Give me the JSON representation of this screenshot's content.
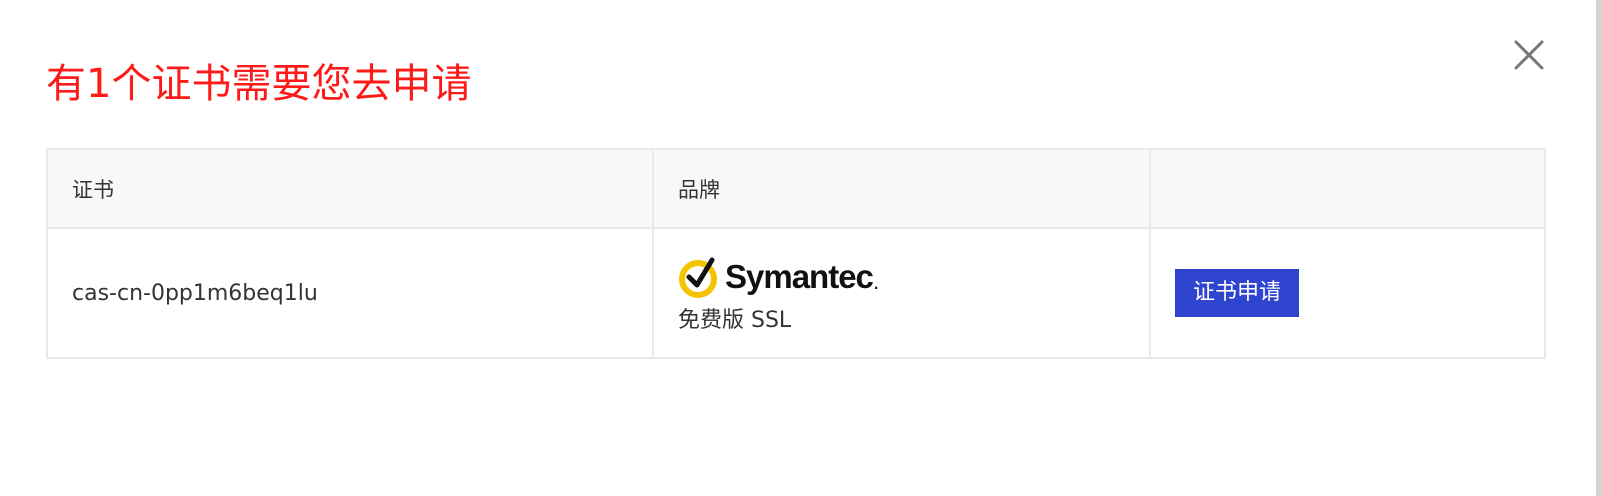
{
  "dialog": {
    "title": "有1个证书需要您去申请",
    "title_color": "#ff1a1a",
    "close_icon": "close-icon"
  },
  "table": {
    "headers": [
      "证书",
      "品牌",
      ""
    ],
    "rows": [
      {
        "certificate": "cas-cn-0pp1m6beq1lu",
        "brand_logo_text": "Symantec",
        "brand_logo_icon": "check-circle-icon",
        "brand_edition": "免费版 SSL",
        "action_label": "证书申请"
      }
    ]
  },
  "colors": {
    "accent_button": "#2f45d0",
    "logo_yellow": "#f5c300",
    "header_bg": "#f8f8f8"
  }
}
